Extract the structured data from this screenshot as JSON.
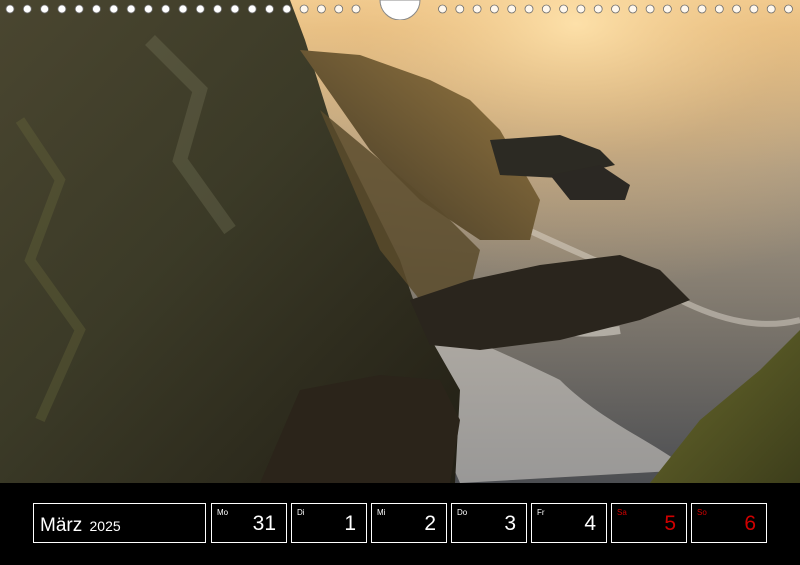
{
  "calendar": {
    "month": "März",
    "year": "2025",
    "days": [
      {
        "abbr": "Mo",
        "num": "31"
      },
      {
        "abbr": "Di",
        "num": "1"
      },
      {
        "abbr": "Mi",
        "num": "2"
      },
      {
        "abbr": "Do",
        "num": "3"
      },
      {
        "abbr": "Fr",
        "num": "4"
      },
      {
        "abbr": "Sa",
        "num": "5"
      },
      {
        "abbr": "So",
        "num": "6"
      }
    ]
  },
  "colors": {
    "strip_background": "#000000",
    "text": "#ffffff",
    "weekend": "#d00000",
    "sunlight": "#f3c27a",
    "sea": "#8d8a80",
    "rock_dark": "#2d2a1c"
  }
}
